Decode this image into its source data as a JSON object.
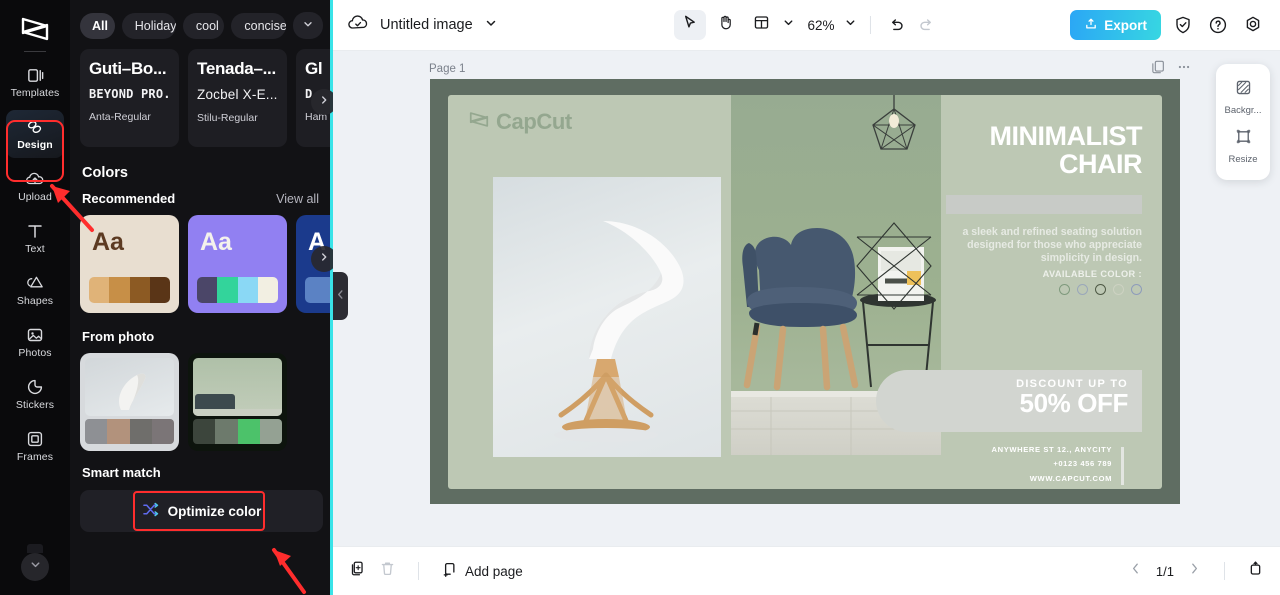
{
  "rail": {
    "logo_icon": "capcut-logo-icon",
    "items": [
      {
        "label": "Templates",
        "icon": "templates-icon",
        "active": false
      },
      {
        "label": "Design",
        "icon": "design-icon",
        "active": true
      },
      {
        "label": "Upload",
        "icon": "upload-cloud-icon",
        "active": false
      },
      {
        "label": "Text",
        "icon": "text-icon",
        "active": false
      },
      {
        "label": "Shapes",
        "icon": "shapes-icon",
        "active": false
      },
      {
        "label": "Photos",
        "icon": "photos-icon",
        "active": false
      },
      {
        "label": "Stickers",
        "icon": "stickers-icon",
        "active": false
      },
      {
        "label": "Frames",
        "icon": "frames-icon",
        "active": false
      }
    ],
    "more_icon": "chevron-down-icon"
  },
  "panel": {
    "chips": [
      {
        "label": "All",
        "active": true
      },
      {
        "label": "Holiday",
        "active": false
      },
      {
        "label": "cool",
        "active": false
      },
      {
        "label": "concise",
        "active": false
      }
    ],
    "chip_caret_icon": "chevron-down-icon",
    "font_cards": [
      {
        "line1": "Guti–Bo...",
        "line2": "BEYOND PRO...",
        "line3": "Anta-Regular"
      },
      {
        "line1": "Tenada–...",
        "line2": "Zocbel X-E...",
        "line3": "Stilu-Regular"
      },
      {
        "line1": "Gl",
        "line2": "D",
        "line3": "Ham"
      }
    ],
    "colors_title": "Colors",
    "recommended_title": "Recommended",
    "view_all": "View all",
    "recommended_swatches": [
      {
        "sample_text": "Aa",
        "bg": "#e8ded0",
        "text_color": "#5c3a22",
        "strip": [
          "#e0b378",
          "#c78f47",
          "#8c5a23",
          "#5a3517"
        ]
      },
      {
        "sample_text": "Aa",
        "bg": "#9180f2",
        "text_color": "#f4f2ec",
        "strip": [
          "#4b4668",
          "#33d49b",
          "#8ad8f5",
          "#f2efe2"
        ]
      },
      {
        "sample_text": "A",
        "bg": "#1b3a8c",
        "text_color": "#ffffff",
        "strip": [
          "#5b82c4",
          "#5b82c4",
          "#5b82c4",
          "#5b82c4"
        ]
      }
    ],
    "from_photo_title": "From photo",
    "from_photo": [
      {
        "strip": [
          "#8e9094",
          "#b2927c",
          "#6f6e6b",
          "#7b7577"
        ]
      },
      {
        "strip": [
          "#3c453c",
          "#6d7a6c",
          "#4cc26a",
          "#94a193"
        ]
      }
    ],
    "smart_match_title": "Smart match",
    "optimize_label": "Optimize color",
    "optimize_icon": "shuffle-icon",
    "carousel_next_icon": "chevron-right-icon",
    "collapse_icon": "chevron-left-icon"
  },
  "topbar": {
    "cloud_icon": "cloud-saved-icon",
    "doc_title": "Untitled image",
    "title_caret_icon": "chevron-down-icon",
    "tools": [
      {
        "name": "select-tool",
        "icon": "cursor-arrow-icon",
        "selected": true
      },
      {
        "name": "hand-tool",
        "icon": "hand-icon",
        "selected": false
      },
      {
        "name": "layout-tool",
        "icon": "layout-grid-icon",
        "selected": false
      }
    ],
    "layout_caret_icon": "chevron-down-icon",
    "zoom_value": "62%",
    "zoom_caret_icon": "chevron-down-icon",
    "undo_icon": "undo-icon",
    "redo_icon": "redo-icon",
    "export_label": "Export",
    "export_icon": "upload-box-icon",
    "export_color": "#2eb5ee",
    "shield_icon": "shield-check-icon",
    "help_icon": "question-circle-icon",
    "settings_icon": "gear-icon"
  },
  "canvas": {
    "page_label": "Page 1",
    "duplicate_icon": "duplicate-page-icon",
    "more_icon": "more-dots-icon",
    "poster": {
      "brand": "CapCut",
      "brand_icon": "capcut-mark-icon",
      "title_line1": "MINIMALIST",
      "title_line2": "CHAIR",
      "description": "a sleek and refined seating solution designed for those who appreciate simplicity in design.",
      "available_color_label": "AVAILABLE COLOR :",
      "color_dots": [
        "#7f9a7d",
        "#9aa7ba",
        "#4f5a46",
        "#cdd2c2",
        "#8e9cbb"
      ],
      "discount_top": "DISCOUNT UP TO",
      "discount_big": "50% OFF",
      "address": "ANYWHERE ST 12., ANYCITY",
      "phone": "+0123 456 789",
      "website": "WWW.CAPCUT.COM"
    }
  },
  "right_float": {
    "items": [
      {
        "label": "Backgr...",
        "icon": "background-icon"
      },
      {
        "label": "Resize",
        "icon": "resize-icon"
      }
    ]
  },
  "bottombar": {
    "duplicate_icon": "duplicate-icon",
    "delete_icon": "trash-icon",
    "add_page_label": "Add page",
    "add_page_icon": "add-page-icon",
    "prev_icon": "chevron-left-icon",
    "page_indicator": "1/1",
    "next_icon": "chevron-right-icon",
    "present_icon": "present-icon"
  }
}
